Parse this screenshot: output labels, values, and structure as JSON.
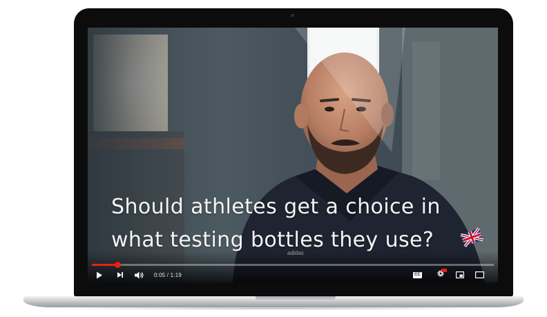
{
  "video": {
    "caption_line1": "Should athletes get a choice in",
    "caption_line2": "what testing bottles they use?",
    "time_display": "0:05 / 1:19",
    "progress_fraction": 0.063,
    "accent_color": "#e62117",
    "badge_text": "adidas"
  },
  "controls": {
    "play_icon": "play-icon",
    "next_icon": "next-icon",
    "volume_icon": "volume-icon",
    "cc_label": "CC",
    "cc_icon": "closed-captions-icon",
    "settings_icon": "gear-icon",
    "miniplayer_icon": "miniplayer-icon",
    "theater_icon": "theater-mode-icon"
  }
}
